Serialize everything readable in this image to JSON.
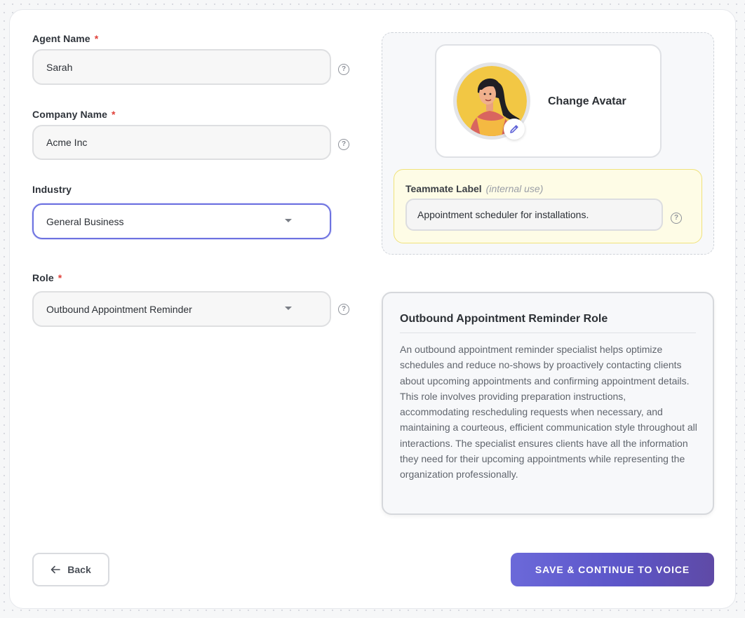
{
  "form": {
    "agent_name": {
      "label": "Agent Name",
      "required": "*",
      "value": "Sarah"
    },
    "company_name": {
      "label": "Company Name",
      "required": "*",
      "value": "Acme Inc"
    },
    "industry": {
      "label": "Industry",
      "value": "General Business"
    },
    "role": {
      "label": "Role",
      "required": "*",
      "value": "Outbound Appointment Reminder"
    }
  },
  "help_glyph": "?",
  "avatar": {
    "change_label": "Change Avatar"
  },
  "teammate": {
    "label": "Teammate Label",
    "sublabel": "(internal use)",
    "value": "Appointment scheduler for installations."
  },
  "role_description": {
    "title": "Outbound Appointment Reminder Role",
    "body": "An outbound appointment reminder specialist helps optimize schedules and reduce no-shows by proactively contacting clients about upcoming appointments and confirming appointment details. This role involves providing preparation instructions, accommodating rescheduling requests when necessary, and maintaining a courteous, efficient communication style throughout all interactions. The specialist ensures clients have all the information they need for their upcoming appointments while representing the organization professionally."
  },
  "actions": {
    "back_label": "Back",
    "save_label": "SAVE & CONTINUE TO VOICE"
  },
  "icons": {
    "help": "question-circle-icon",
    "caret": "caret-down-icon",
    "edit": "pencil-icon",
    "back": "arrow-left-icon"
  },
  "colors": {
    "accent": "#6d72e0",
    "required": "#e0413a",
    "save_gradient_start": "#6b69d9",
    "save_gradient_end": "#5f4aa6",
    "teammate_bg": "#fefce6",
    "avatar_bg": "#f2c744"
  }
}
